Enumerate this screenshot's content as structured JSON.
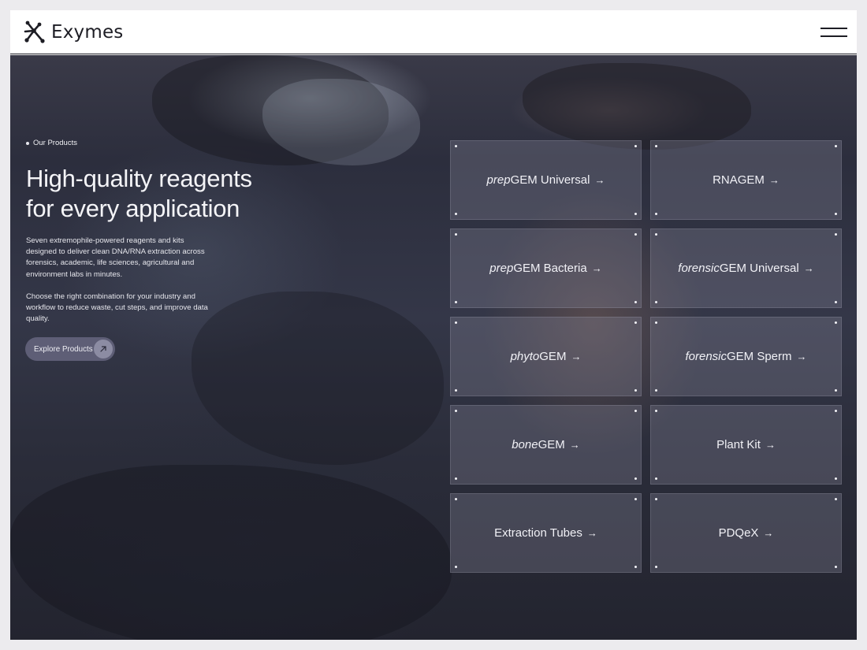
{
  "brand": {
    "name": "Exymes",
    "icon": "molecule-logo-icon"
  },
  "header": {
    "menu_icon": "hamburger-menu-icon"
  },
  "hero": {
    "eyebrow": "Our Products",
    "headline_line1": "High-quality reagents",
    "headline_line2": "for every application",
    "paragraph1": "Seven extremophile-powered reagents and kits designed to deliver clean DNA/RNA extraction across forensics, academic, life sciences, agricultural and environment labs in minutes.",
    "paragraph2": "Choose the right combination for your industry and workflow to reduce waste, cut steps, and improve data quality.",
    "cta_label": "Explore Products",
    "cta_icon": "arrow-up-right-icon"
  },
  "products": [
    {
      "prefix": "prep",
      "name": "GEM Universal"
    },
    {
      "prefix": "",
      "name": "RNAGEM"
    },
    {
      "prefix": "prep",
      "name": "GEM Bacteria"
    },
    {
      "prefix": "forensic",
      "name": "GEM Universal"
    },
    {
      "prefix": "phyto",
      "name": "GEM"
    },
    {
      "prefix": "forensic",
      "name": "GEM Sperm"
    },
    {
      "prefix": "bone",
      "name": "GEM"
    },
    {
      "prefix": "",
      "name": "Plant Kit"
    },
    {
      "prefix": "",
      "name": "Extraction Tubes"
    },
    {
      "prefix": "",
      "name": "PDQeX"
    }
  ],
  "arrow_glyph": "→",
  "colors": {
    "text_dark": "#1d1d24",
    "cta_bg": "#5e5e76",
    "card_bg": "rgba(120,122,140,0.38)"
  }
}
